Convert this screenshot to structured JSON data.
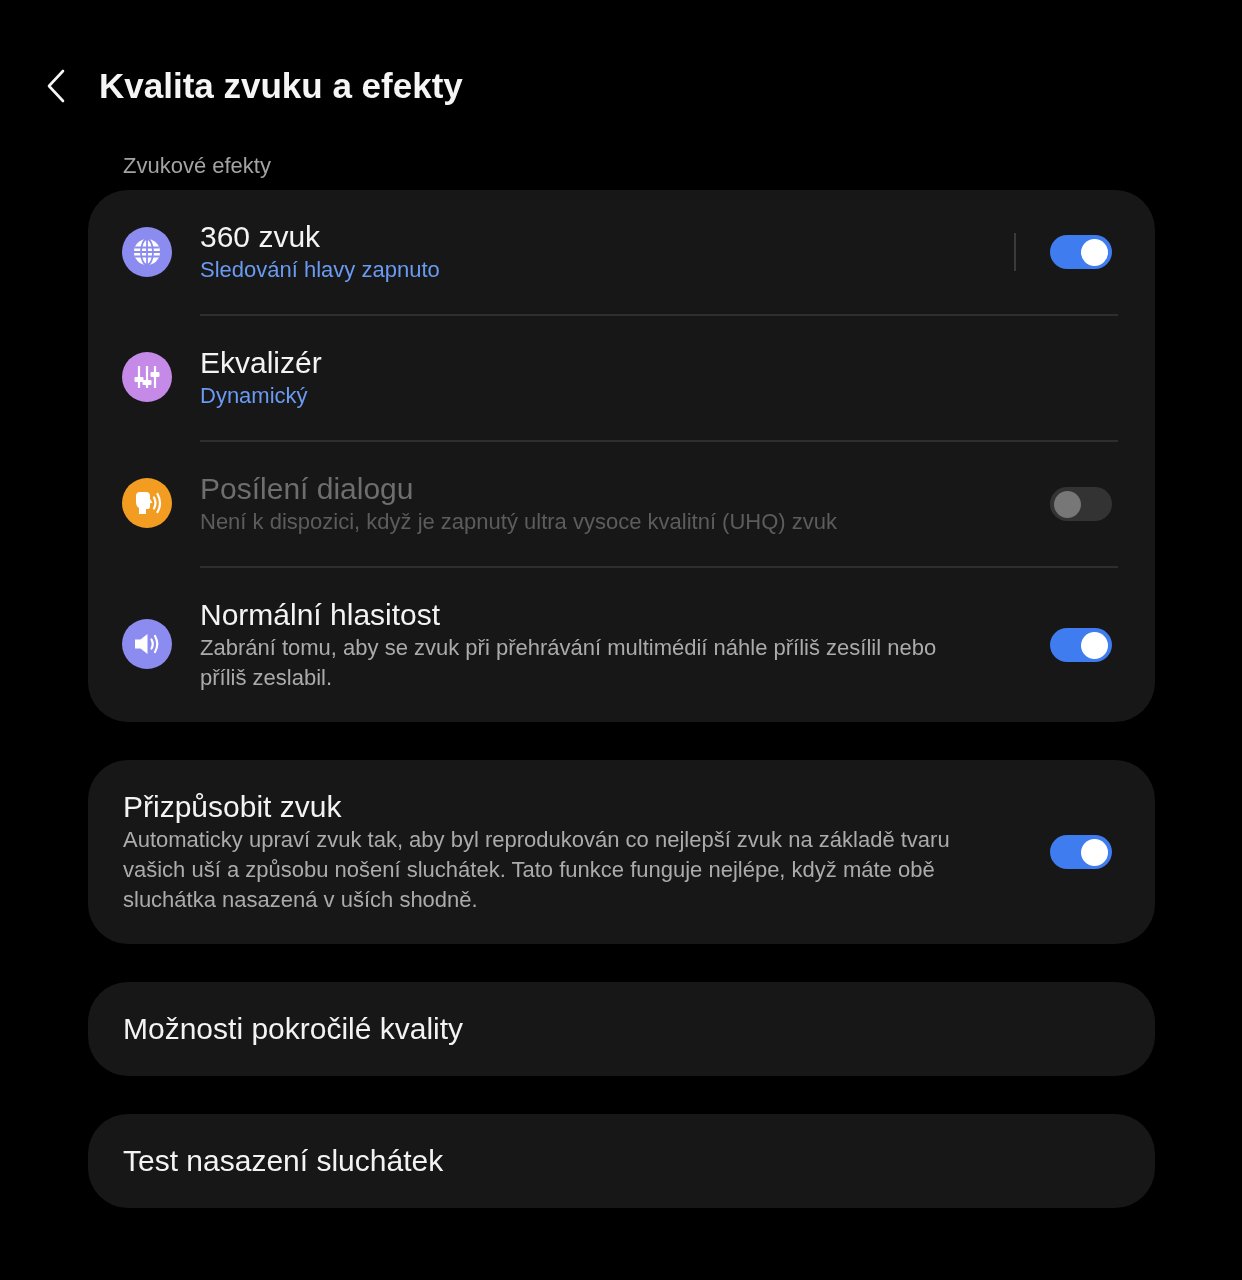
{
  "header": {
    "title": "Kvalita zvuku a efekty"
  },
  "groups": [
    {
      "label": "Zvukové efekty",
      "items": [
        {
          "title": "360 zvuk",
          "value": "Sledování hlavy zapnuto",
          "disabled": false,
          "split": true,
          "switch": {
            "on": true
          }
        },
        {
          "title": "Ekvalizér",
          "value": "Dynamický",
          "disabled": false,
          "split": false
        },
        {
          "title": "Posílení dialogu",
          "description": "Není k dispozici, když je zapnutý ultra vysoce kvalitní (UHQ) zvuk",
          "disabled": true,
          "split": false,
          "switch": {
            "on": false
          }
        },
        {
          "title": "Normální hlasitost",
          "description": "Zabrání tomu, aby se zvuk při přehrávání multimédií náhle příliš zesílil nebo příliš zeslabil.",
          "disabled": false,
          "split": false,
          "switch": {
            "on": true
          }
        }
      ]
    },
    {
      "items": [
        {
          "title": "Přizpůsobit zvuk",
          "description": "Automaticky upraví zvuk tak, aby byl reprodukován co nejlepší zvuk na základě tvaru vašich uší a způsobu nošení sluchátek. Tato funkce funguje nejlépe, když máte obě sluchátka nasazená v uších shodně.",
          "disabled": false,
          "split": false,
          "switch": {
            "on": true
          }
        }
      ]
    },
    {
      "items": [
        {
          "title": "Možnosti pokročilé kvality",
          "disabled": false
        }
      ]
    },
    {
      "items": [
        {
          "title": "Test nasazení sluchátek",
          "disabled": false
        }
      ]
    }
  ]
}
